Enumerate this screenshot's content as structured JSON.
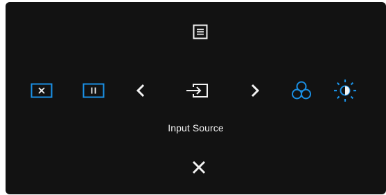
{
  "osd": {
    "caption": "Input Source",
    "icons": {
      "top": "menu-icon",
      "row": [
        "pip-close-icon",
        "pip-split-icon",
        "chevron-left-icon",
        "input-source-icon",
        "chevron-right-icon",
        "color-icon",
        "brightness-icon"
      ],
      "bottom": "close-icon"
    },
    "colors": {
      "background": "#121212",
      "white": "#f2f2f2",
      "accent": "#1a8fe3"
    }
  }
}
